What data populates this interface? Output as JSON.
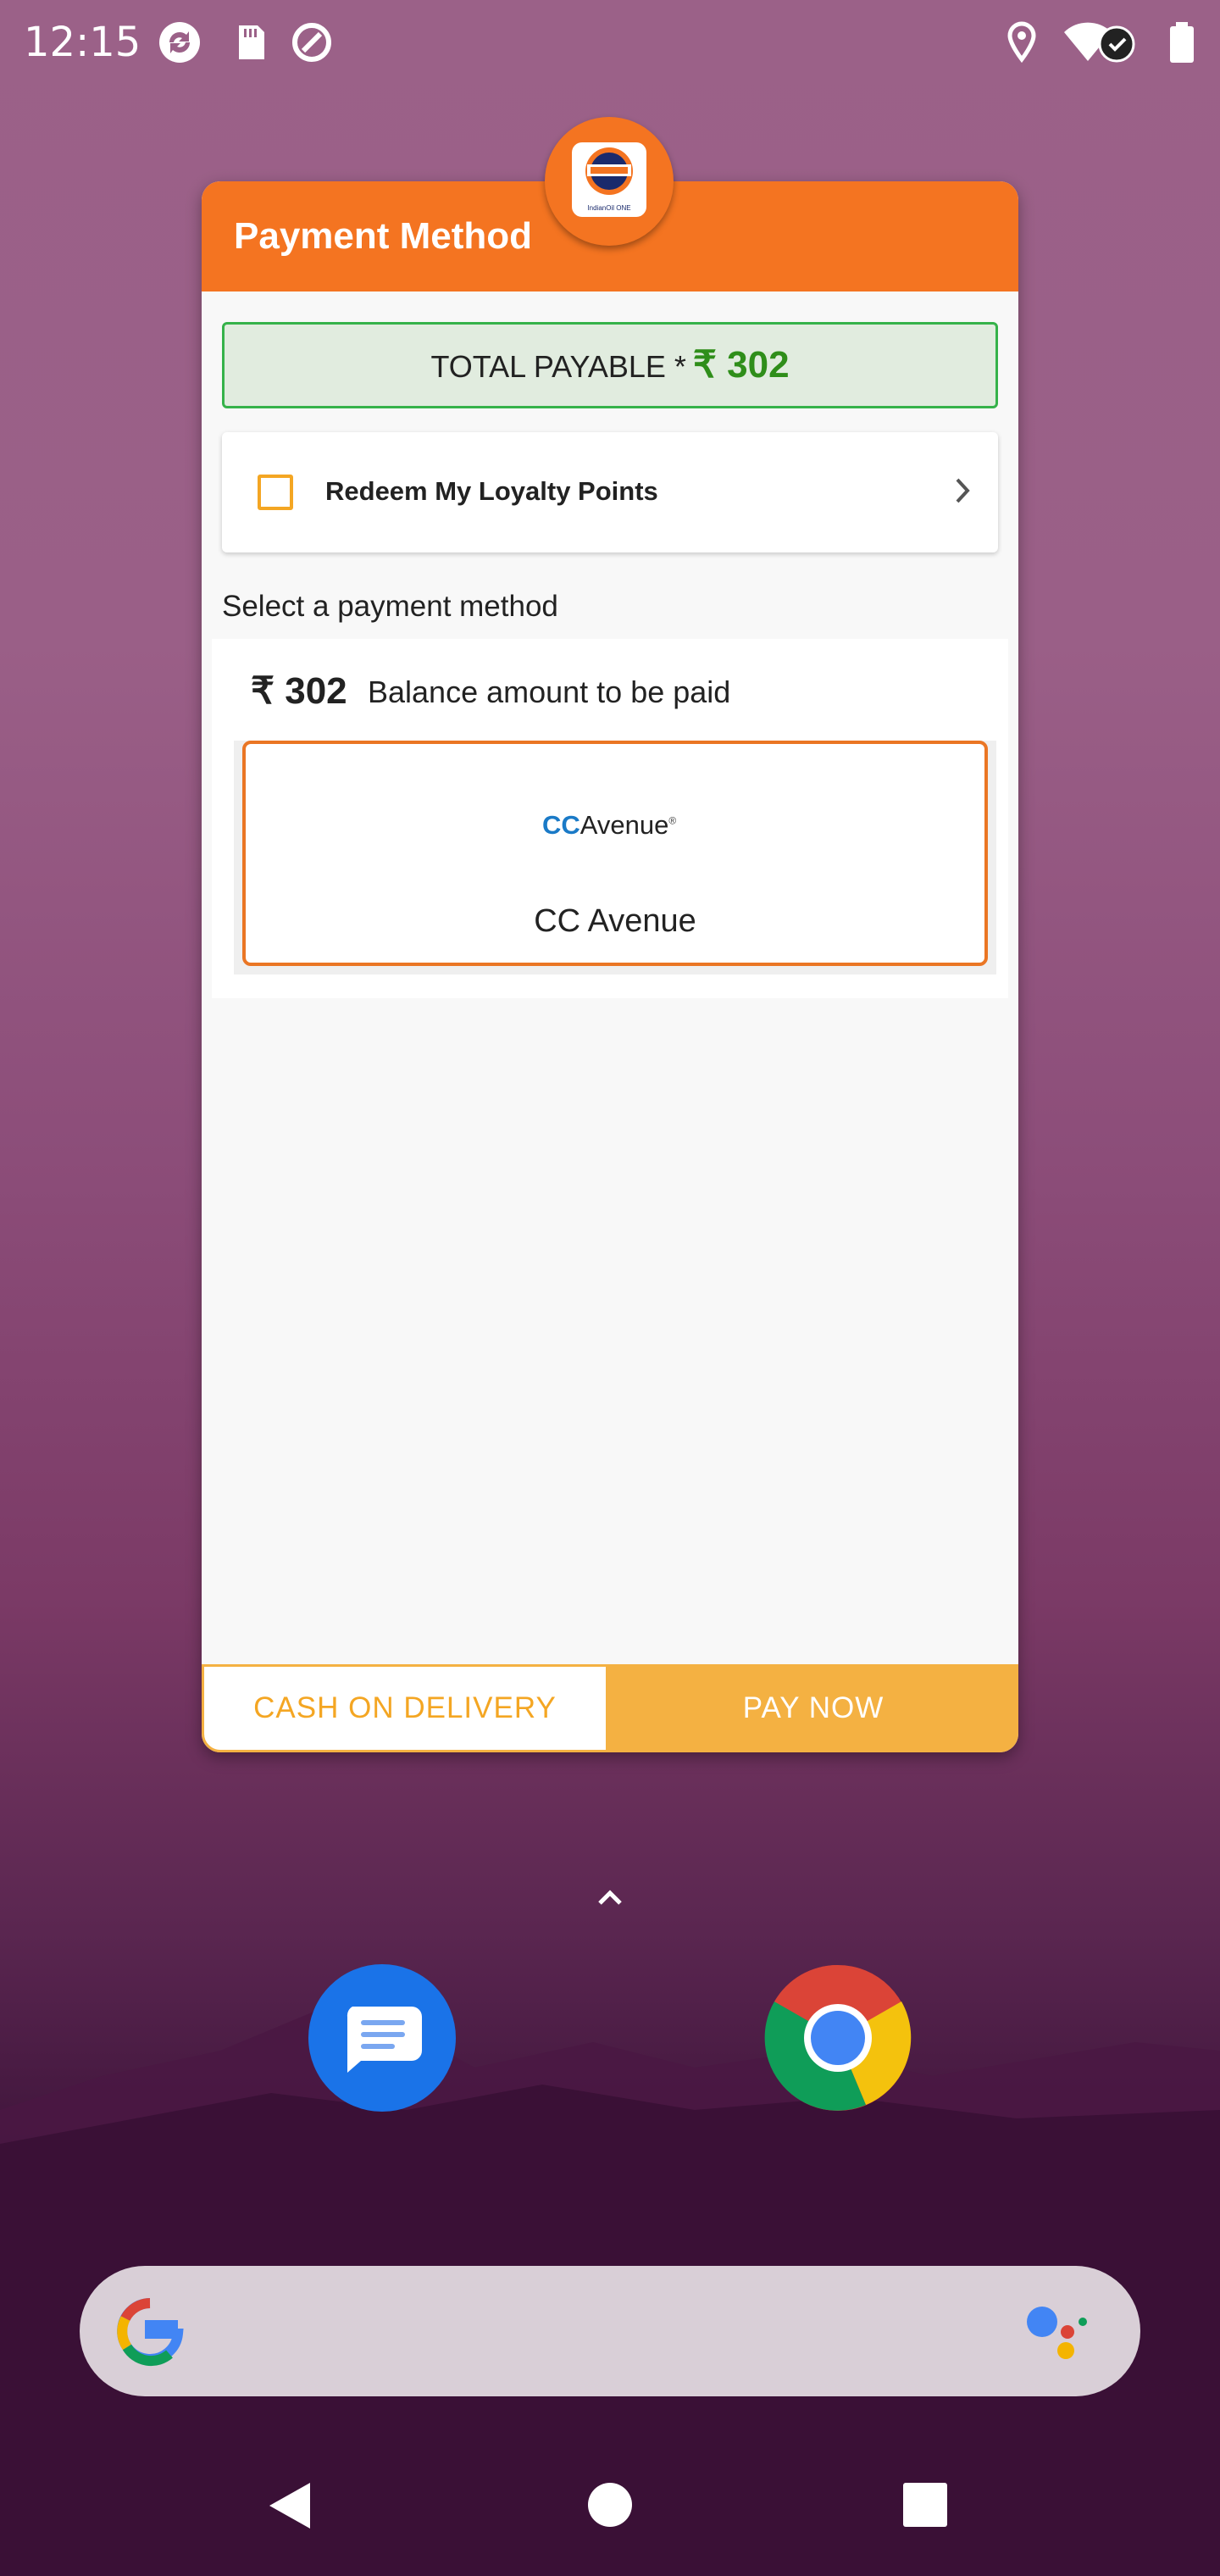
{
  "status_bar": {
    "time": "12:15",
    "left_icons": [
      "sync-icon",
      "sd-card-icon",
      "vpn-icon"
    ],
    "right_icons": [
      "location-icon",
      "wifi-icon",
      "battery-icon"
    ]
  },
  "dialog": {
    "title": "Payment Method",
    "logo_caption": "IndianOil ONE",
    "total": {
      "label": "TOTAL PAYABLE *",
      "amount": "₹ 302"
    },
    "loyalty": {
      "label": "Redeem My Loyalty Points",
      "checked": false
    },
    "select_label": "Select a payment method",
    "balance": {
      "amount": "₹ 302",
      "label": "Balance amount to be paid"
    },
    "payment_option": {
      "logo_cc": "CC",
      "logo_avenue": "Avenue",
      "logo_reg": "®",
      "name": "CC Avenue"
    },
    "buttons": {
      "cod": "CASH ON DELIVERY",
      "pay": "PAY NOW"
    }
  },
  "home": {
    "dock": [
      "messages-app-icon",
      "chrome-app-icon"
    ],
    "search_icons": [
      "google-g-icon",
      "assistant-icon"
    ]
  },
  "colors": {
    "header": "#f47421",
    "accent_yellow": "#f4b142",
    "total_green": "#2f8e1a",
    "cc_blue": "#1a7ac7"
  }
}
